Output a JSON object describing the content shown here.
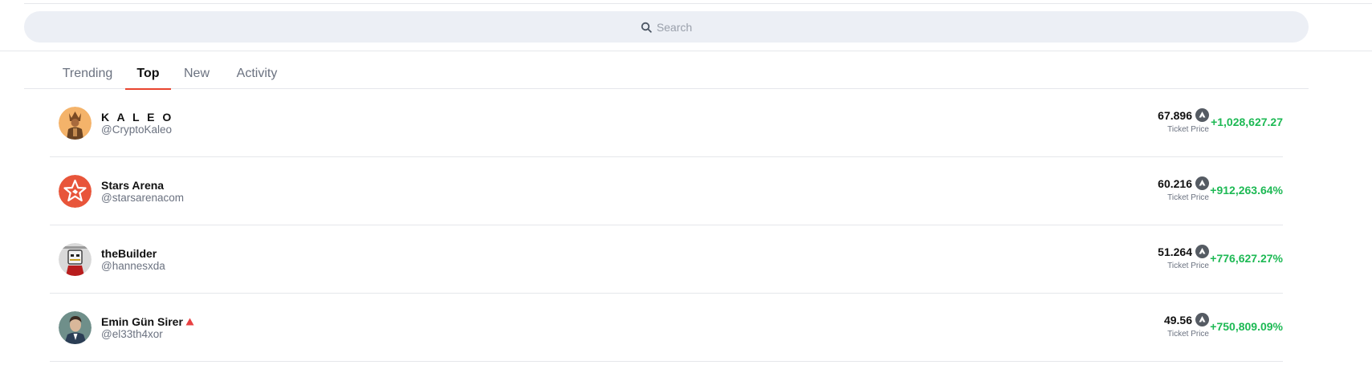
{
  "search": {
    "placeholder": "Search"
  },
  "tabs": [
    {
      "label": "Trending",
      "active": false
    },
    {
      "label": "Top",
      "active": true
    },
    {
      "label": "New",
      "active": false
    },
    {
      "label": "Activity",
      "active": false
    }
  ],
  "users": [
    {
      "name": "K A L E O",
      "handle": "@CryptoKaleo",
      "price": "67.896",
      "price_label": "Ticket Price",
      "change": "+1,028,627.27"
    },
    {
      "name": "Stars Arena",
      "handle": "@starsarenacom",
      "price": "60.216",
      "price_label": "Ticket Price",
      "change": "+912,263.64%"
    },
    {
      "name": "theBuilder",
      "handle": "@hannesxda",
      "price": "51.264",
      "price_label": "Ticket Price",
      "change": "+776,627.27%"
    },
    {
      "name": "Emin Gün Sirer",
      "handle": "@el33th4xor",
      "price": "49.56",
      "price_label": "Ticket Price",
      "change": "+750,809.09%",
      "verified": true
    }
  ],
  "icons": {
    "search": "search-icon",
    "currency": "avax-icon",
    "verified": "avalanche-triangle-icon"
  },
  "colors": {
    "accent": "#e8442f",
    "positive": "#1db954",
    "search_bg": "#eceff5",
    "muted_text": "#6b7280",
    "verified": "#e84142"
  }
}
